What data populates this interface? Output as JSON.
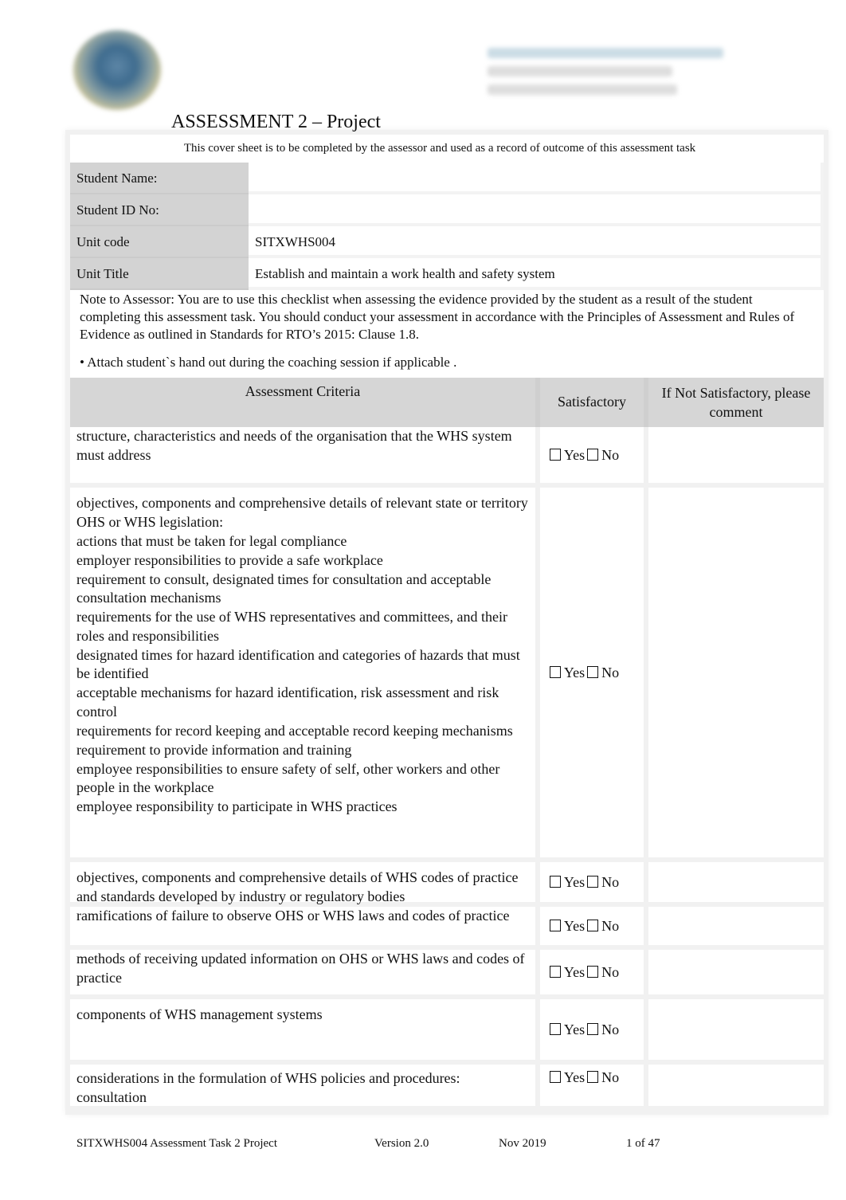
{
  "header": {
    "logo_icon": "college-logo-icon",
    "title": "ASSESSMENT 2 – Project",
    "subtitle": "This cover sheet is to be completed by the assessor and used as a record of outcome of this assessment task"
  },
  "info": {
    "rows": [
      {
        "label": "Student Name:",
        "value": ""
      },
      {
        "label": "Student ID No:",
        "value": ""
      },
      {
        "label": "Unit code",
        "value": "SITXWHS004"
      },
      {
        "label": "Unit Title",
        "value": "Establish and maintain a work health and safety system"
      }
    ]
  },
  "note": {
    "text": "Note to Assessor:  You are to use this checklist when assessing the evidence provided by the student as a result of the student completing this assessment task. You should conduct your assessment in accordance with the Principles of Assessment and Rules of Evidence as outlined in Standards for RTO’s 2015: Clause 1.8.",
    "bullet": "• Attach student`s hand out during the coaching session if applicable   ."
  },
  "criteria": {
    "headers": {
      "criteria": "Assessment Criteria",
      "satisfactory": "Satisfactory",
      "comment": "If Not Satisfactory, please comment"
    },
    "yes_label": "Yes",
    "no_label": "No",
    "rows": [
      {
        "lines": [
          "structure, characteristics and needs of the organisation that the WHS system must address"
        ],
        "yes": false,
        "no": false,
        "comment": ""
      },
      {
        "lines": [
          "objectives, components and comprehensive details of relevant state or territory OHS or WHS legislation:",
          "actions that must be taken for legal compliance",
          "employer responsibilities to provide a safe workplace",
          "requirement to consult, designated times for consultation and acceptable consultation mechanisms",
          "requirements for the use of WHS representatives and committees, and their roles and responsibilities",
          "designated times for hazard identification and categories of hazards that must be identified",
          "acceptable mechanisms for hazard identification, risk assessment and risk control",
          "requirements for record keeping and acceptable record keeping mechanisms",
          "requirement to provide information and training",
          "employee responsibilities to ensure safety of self, other workers and other people in the workplace",
          "employee responsibility to participate in WHS practices"
        ],
        "yes": false,
        "no": false,
        "comment": ""
      },
      {
        "lines": [
          "objectives, components and comprehensive details of WHS codes of practice and standards developed by industry or regulatory bodies"
        ],
        "yes": false,
        "no": false,
        "comment": ""
      },
      {
        "lines": [
          "ramifications of failure to observe OHS or WHS laws and codes of practice"
        ],
        "yes": false,
        "no": false,
        "comment": ""
      },
      {
        "lines": [
          "methods of receiving updated information on OHS or WHS laws and codes of practice"
        ],
        "yes": false,
        "no": false,
        "comment": ""
      },
      {
        "lines": [
          "components of WHS management systems"
        ],
        "yes": false,
        "no": false,
        "comment": ""
      },
      {
        "lines": [
          "considerations in the formulation of WHS policies and procedures:",
          "consultation"
        ],
        "yes": false,
        "no": false,
        "comment": ""
      }
    ]
  },
  "footer": {
    "doc_name": "SITXWHS004 Assessment Task 2 Project",
    "version": "Version 2.0",
    "date": "Nov 2019",
    "page": "1  of  47"
  }
}
